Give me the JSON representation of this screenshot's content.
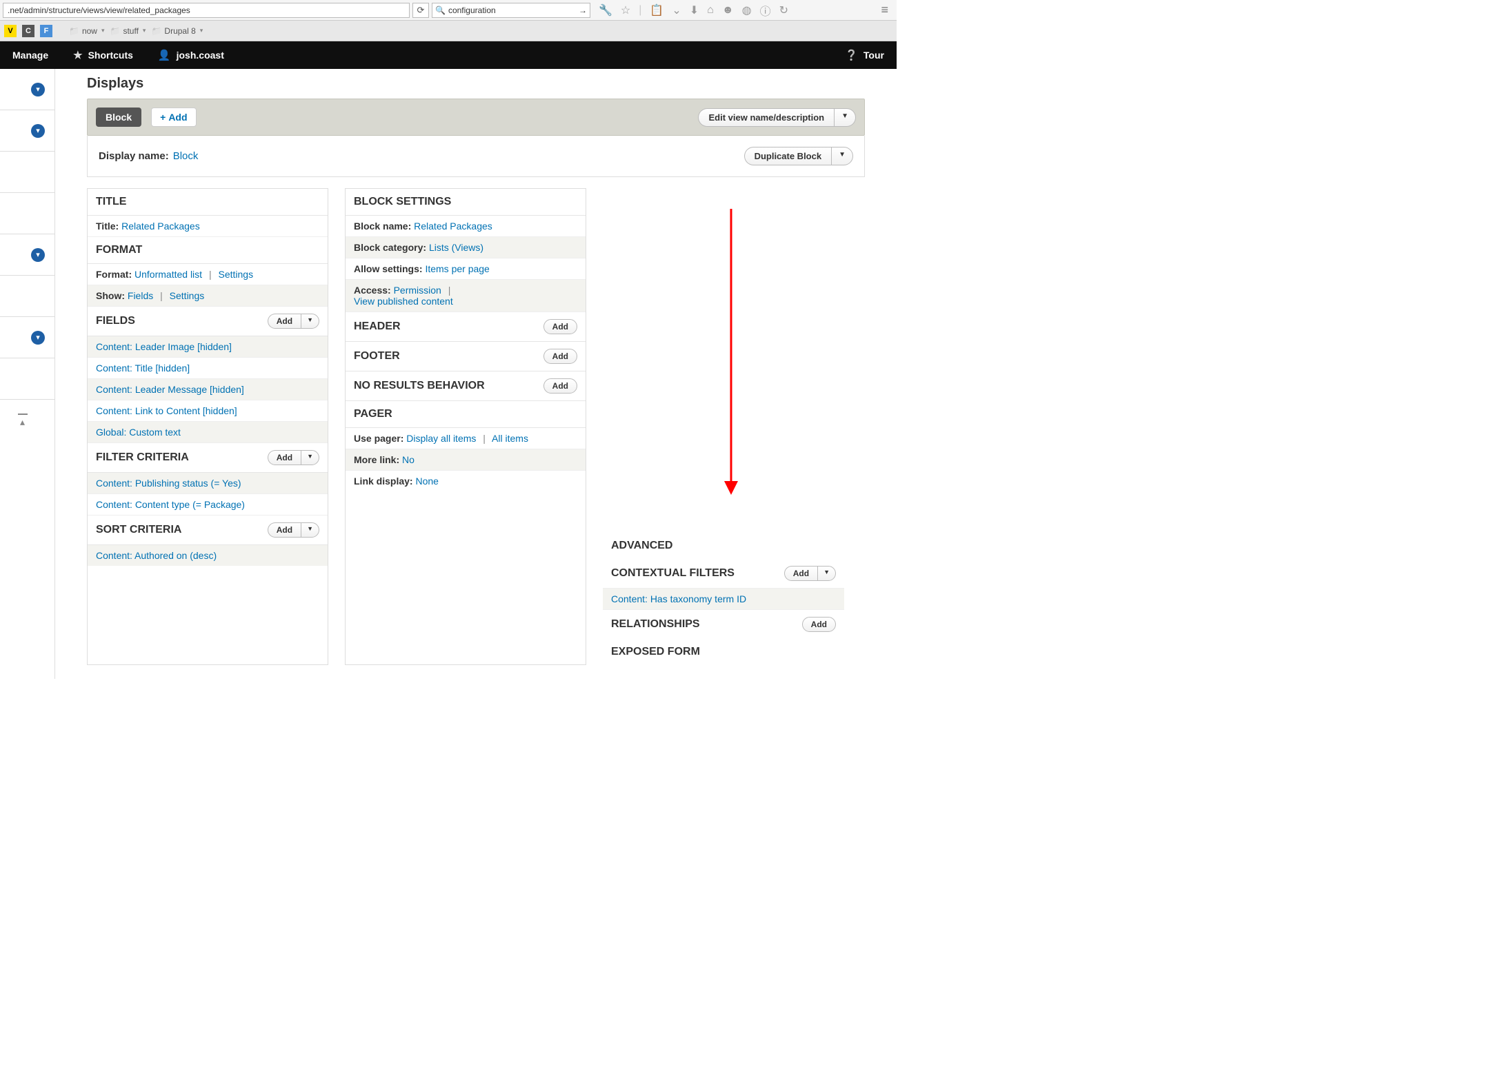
{
  "browser": {
    "url": ".net/admin/structure/views/view/related_packages",
    "search": "configuration"
  },
  "bookmarks": {
    "folder1": "now",
    "folder2": "stuff",
    "folder3": "Drupal 8"
  },
  "toolbar": {
    "manage": "Manage",
    "shortcuts": "Shortcuts",
    "user": "josh.coast",
    "tour": "Tour"
  },
  "page": {
    "displays_heading": "Displays",
    "block_tab": "Block",
    "add_btn": "Add",
    "edit_view_btn": "Edit view name/description",
    "display_name_label": "Display name:",
    "display_name_value": "Block",
    "duplicate_btn": "Duplicate Block"
  },
  "col1": {
    "title_header": "TITLE",
    "title_label": "Title:",
    "title_value": "Related Packages",
    "format_header": "FORMAT",
    "format_label": "Format:",
    "format_value": "Unformatted list",
    "settings": "Settings",
    "show_label": "Show:",
    "show_value": "Fields",
    "fields_header": "FIELDS",
    "field1": "Content: Leader Image [hidden]",
    "field2": "Content: Title [hidden]",
    "field3": "Content: Leader Message [hidden]",
    "field4": "Content: Link to Content [hidden]",
    "field5": "Global: Custom text",
    "filter_header": "FILTER CRITERIA",
    "filter1": "Content: Publishing status (= Yes)",
    "filter2": "Content: Content type (= Package)",
    "sort_header": "SORT CRITERIA",
    "sort1": "Content: Authored on (desc)",
    "add": "Add"
  },
  "col2": {
    "block_settings_header": "BLOCK SETTINGS",
    "block_name_label": "Block name:",
    "block_name_value": "Related Packages",
    "block_cat_label": "Block category:",
    "block_cat_value": "Lists (Views)",
    "allow_label": "Allow settings:",
    "allow_value": "Items per page",
    "access_label": "Access:",
    "access_value": "Permission",
    "access_value2": "View published content",
    "header_header": "HEADER",
    "footer_header": "FOOTER",
    "noresults_header": "NO RESULTS BEHAVIOR",
    "pager_header": "PAGER",
    "pager_label": "Use pager:",
    "pager_value": "Display all items",
    "pager_value2": "All items",
    "more_label": "More link:",
    "more_value": "No",
    "linkdisp_label": "Link display:",
    "linkdisp_value": "None",
    "add": "Add"
  },
  "col3": {
    "advanced": "ADVANCED",
    "contextual": "CONTEXTUAL FILTERS",
    "cf1": "Content: Has taxonomy term ID",
    "relationships": "RELATIONSHIPS",
    "exposed": "EXPOSED FORM",
    "add": "Add"
  }
}
